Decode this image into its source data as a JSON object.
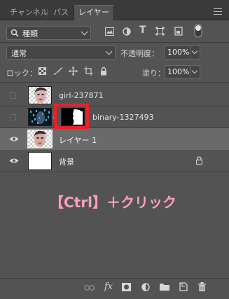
{
  "tabs": [
    {
      "label": "チャンネル",
      "active": false
    },
    {
      "label": "パス",
      "active": false
    },
    {
      "label": "レイヤー",
      "active": true
    }
  ],
  "filter": {
    "kind_label": "種類",
    "icons": [
      "image-filter-icon",
      "adjustment-filter-icon",
      "type-filter-icon",
      "shape-filter-icon",
      "smart-object-filter-icon",
      "filter-toggle-icon"
    ]
  },
  "blend": {
    "mode": "通常",
    "opacity_label": "不透明度：",
    "opacity_value": "100%"
  },
  "lock": {
    "label": "ロック：",
    "fill_label": "塗り：",
    "fill_value": "100%",
    "icons": [
      "lock-transparent-pixels-icon",
      "lock-image-pixels-icon",
      "lock-position-icon",
      "lock-artboard-icon",
      "lock-all-icon"
    ]
  },
  "layers": [
    {
      "name": "girl-237871",
      "visible": false,
      "selected": false
    },
    {
      "name": "binary-1327493",
      "visible": false,
      "selected": false,
      "has_mask": true
    },
    {
      "name": "レイヤー 1",
      "visible": true,
      "selected": true
    },
    {
      "name": "背景",
      "visible": true,
      "selected": false,
      "locked": true
    }
  ],
  "annotation": {
    "text": "【Ctrl】＋クリック",
    "color": "#ff9ec1",
    "highlight_color": "#e8212b"
  },
  "colors": {
    "panel_bg": "#535353",
    "selected_row": "#6a6a6a"
  },
  "footer_icons": [
    "link-layers-icon",
    "fx-icon",
    "add-mask-icon",
    "adjustment-layer-icon",
    "new-group-icon",
    "new-layer-icon",
    "delete-icon"
  ]
}
